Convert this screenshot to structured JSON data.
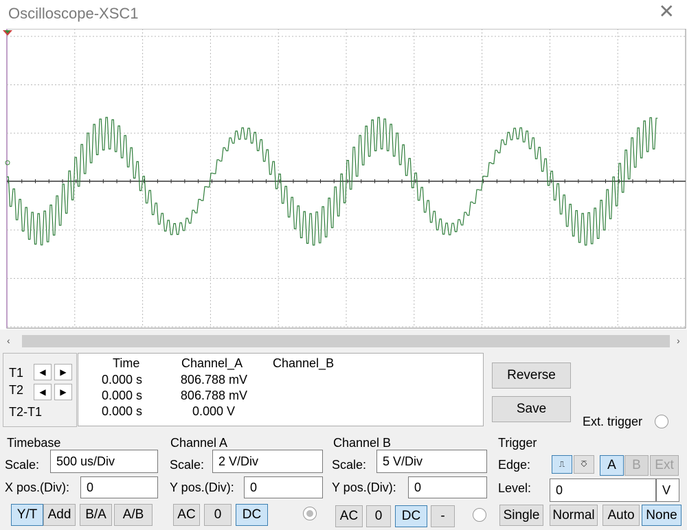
{
  "window": {
    "title": "Oscilloscope-XSC1",
    "close_icon": "close-icon"
  },
  "trace_color": "#2e7d3a",
  "cursors": {
    "t1_label": "T1",
    "t2_label": "T2",
    "diff_label": "T2-T1"
  },
  "readout": {
    "headers": [
      "Time",
      "Channel_A",
      "Channel_B"
    ],
    "rows": [
      {
        "time": "0.000 s",
        "channel_a": "806.788 mV",
        "channel_b": ""
      },
      {
        "time": "0.000 s",
        "channel_a": "806.788 mV",
        "channel_b": ""
      },
      {
        "time": "0.000 s",
        "channel_a": "0.000 V",
        "channel_b": ""
      }
    ]
  },
  "buttons": {
    "reverse": "Reverse",
    "save": "Save"
  },
  "ext_trigger": {
    "label": "Ext. trigger"
  },
  "timebase": {
    "title": "Timebase",
    "scale_label": "Scale:",
    "scale_value": "500 us/Div",
    "xpos_label": "X pos.(Div):",
    "xpos_value": "0",
    "modes": [
      "Y/T",
      "Add",
      "B/A",
      "A/B"
    ],
    "active_mode": "Y/T"
  },
  "channel_a": {
    "title": "Channel A",
    "scale_label": "Scale:",
    "scale_value": "2  V/Div",
    "ypos_label": "Y pos.(Div):",
    "ypos_value": "0",
    "coupling": [
      "AC",
      "0",
      "DC"
    ],
    "active_coupling": "DC"
  },
  "channel_b": {
    "title": "Channel B",
    "scale_label": "Scale:",
    "scale_value": "5  V/Div",
    "ypos_label": "Y pos.(Div):",
    "ypos_value": "0",
    "coupling": [
      "AC",
      "0",
      "DC",
      "-"
    ],
    "active_coupling": "DC"
  },
  "trigger": {
    "title": "Trigger",
    "edge_label": "Edge:",
    "level_label": "Level:",
    "level_value": "0",
    "level_unit": "V",
    "sources": [
      "A",
      "B",
      "Ext"
    ],
    "active_source": "A",
    "modes": [
      "Single",
      "Normal",
      "Auto",
      "None"
    ],
    "active_mode": "None"
  }
}
